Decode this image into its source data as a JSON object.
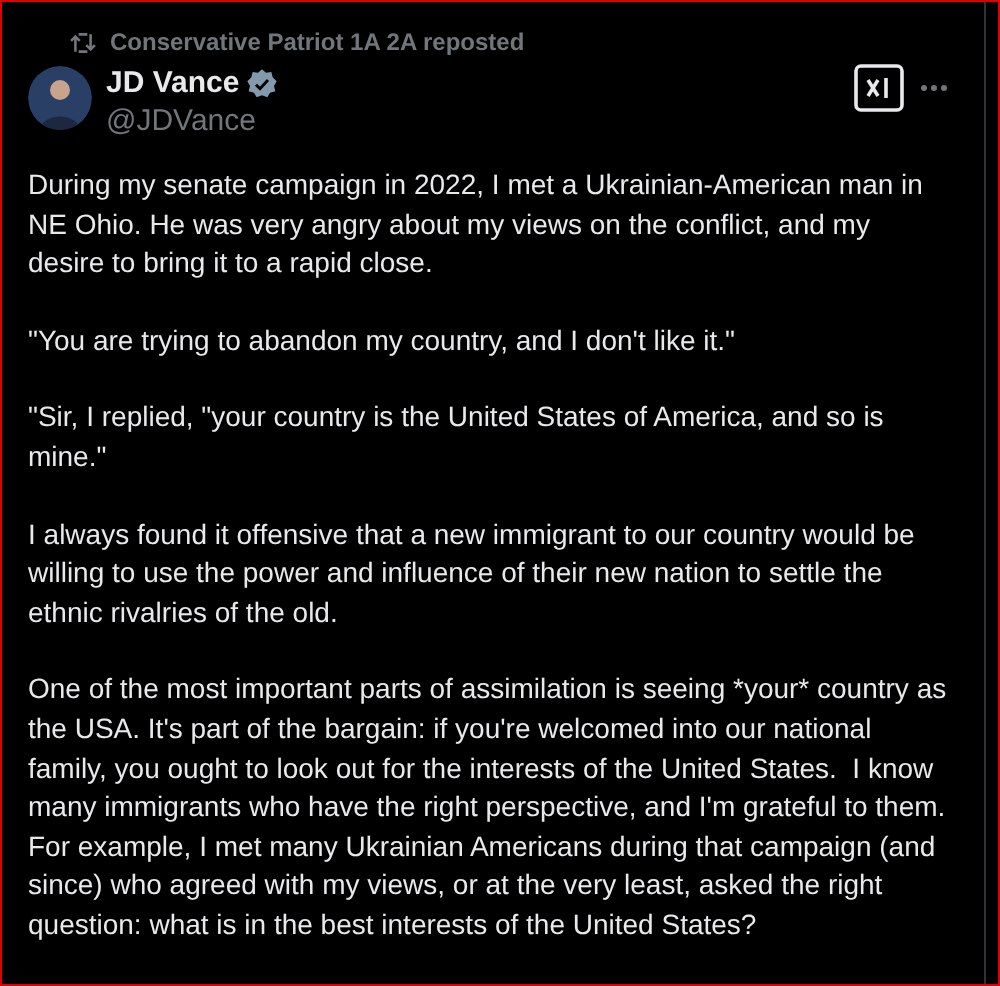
{
  "repost": {
    "text": "Conservative Patriot 1A 2A reposted"
  },
  "author": {
    "name": "JD Vance",
    "verified": true,
    "handle": "@JDVance"
  },
  "paragraphs": [
    "During my senate campaign in 2022, I met a Ukrainian-American man in NE Ohio. He was very angry about my views on the conflict, and my desire to bring it to a rapid close.",
    "\"You are trying to abandon my country, and I don't like it.\"",
    "\"Sir, I replied, \"your country is the United States of America, and so is mine.\"",
    "I always found it offensive that a new immigrant to our country would be willing to use the power and influence of their new nation to settle the ethnic rivalries of the old.",
    "One of the most important parts of assimilation is seeing *your* country as the USA. It's part of the bargain: if you're welcomed into our national family, you ought to look out for the interests of the United States.  I know many immigrants who have the right perspective, and I'm grateful to them. For example, I met many Ukrainian Americans during that campaign (and since) who agreed with my views, or at the very least, asked the right question: what is in the best interests of the United States?"
  ]
}
